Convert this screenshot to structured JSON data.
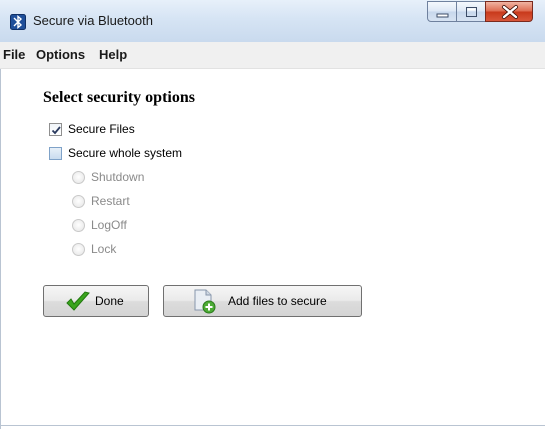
{
  "window": {
    "title": "Secure via Bluetooth"
  },
  "menu": {
    "items": [
      "File",
      "Options",
      "Help"
    ]
  },
  "main": {
    "heading": "Select security options",
    "checkboxes": [
      {
        "label": "Secure Files",
        "checked": true
      },
      {
        "label": "Secure whole system",
        "checked": false
      }
    ],
    "radios": [
      {
        "label": "Shutdown",
        "enabled": false
      },
      {
        "label": "Restart",
        "enabled": false
      },
      {
        "label": "LogOff",
        "enabled": false
      },
      {
        "label": "Lock",
        "enabled": false
      }
    ],
    "buttons": {
      "done_label": "Done",
      "add_files_label": "Add files to secure"
    }
  },
  "icons": {
    "app": "bluetooth-lock-icon",
    "minimize": "minimize-icon",
    "maximize": "maximize-icon",
    "close": "close-icon",
    "done": "checkmark-icon",
    "add_files": "add-files-icon"
  },
  "colors": {
    "titlebar": "#d6e4f4",
    "close_button": "#c8391b",
    "done_check": "#3aa51e",
    "disabled_text": "#8a8a8a"
  }
}
